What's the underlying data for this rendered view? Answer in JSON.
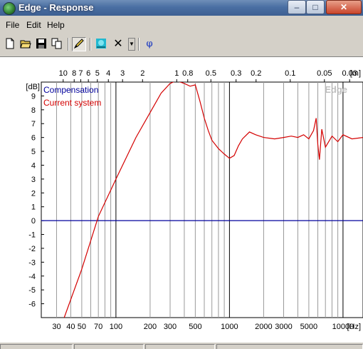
{
  "window": {
    "title": "Edge - Response"
  },
  "menu": [
    "File",
    "Edit",
    "Help"
  ],
  "toolbar": {
    "buttons": [
      "new-file-icon",
      "open-folder-icon",
      "save-disk-icon",
      "copy-icon",
      "draw-pen-icon",
      "grid-view-icon",
      "delete-x-icon",
      "dropdown-arrow-icon",
      "phase-phi-icon"
    ],
    "phase_label": "φ"
  },
  "chart_data": {
    "type": "line",
    "watermark": "Edge",
    "ylabel": "[dB]",
    "xlabel": "[Hz]",
    "top_unit": "[m]",
    "x_scale": "log",
    "xlim": [
      22,
      15000
    ],
    "ylim": [
      -7,
      10
    ],
    "grid": true,
    "legend_position": "top-left",
    "y_ticks": [
      9,
      8,
      7,
      6,
      5,
      4,
      3,
      2,
      1,
      0,
      -1,
      -2,
      -3,
      -4,
      -5,
      -6
    ],
    "x_ticks": [
      30,
      40,
      50,
      70,
      100,
      200,
      300,
      500,
      1000,
      2000,
      3000,
      5000,
      10000
    ],
    "x_tick_labels": [
      "30",
      "40",
      "50",
      "70",
      "100",
      "200",
      "300",
      "500",
      "1000",
      "2000",
      "3000",
      "5000",
      "10000"
    ],
    "top_ticks": [
      "10",
      "8",
      "7",
      "6",
      "5",
      "4",
      "3",
      "2",
      "1",
      "0.8",
      "0.5",
      "0.3",
      "0.2",
      "0.1",
      "0.05",
      "0.03"
    ],
    "series": [
      {
        "name": "Compensation",
        "color": "#00009c",
        "x": [
          22,
          15000
        ],
        "y": [
          0,
          0
        ]
      },
      {
        "name": "Current system",
        "color": "#d40000",
        "x": [
          35,
          50,
          70,
          100,
          150,
          200,
          250,
          300,
          340,
          400,
          450,
          500,
          550,
          600,
          650,
          700,
          800,
          900,
          1000,
          1100,
          1200,
          1300,
          1500,
          1700,
          2000,
          2500,
          3000,
          3500,
          4000,
          4500,
          5000,
          5500,
          5800,
          6000,
          6200,
          6500,
          7000,
          8000,
          9000,
          10000,
          12000,
          15000
        ],
        "y": [
          -7.0,
          -3.5,
          0.3,
          3.0,
          6.0,
          7.8,
          9.2,
          9.9,
          10.1,
          9.9,
          9.7,
          9.8,
          8.6,
          7.4,
          6.5,
          5.8,
          5.2,
          4.8,
          4.5,
          4.7,
          5.4,
          5.9,
          6.4,
          6.2,
          6.0,
          5.9,
          6.0,
          6.1,
          6.0,
          6.2,
          5.9,
          6.5,
          7.4,
          5.5,
          4.4,
          6.6,
          5.3,
          6.1,
          5.7,
          6.2,
          5.9,
          6.0
        ]
      }
    ]
  }
}
